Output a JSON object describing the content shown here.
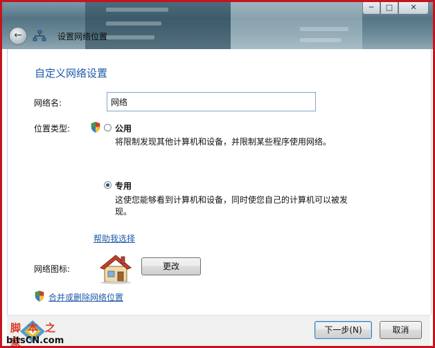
{
  "window": {
    "controls": {
      "minimize": "─",
      "maximize": "□",
      "close": "✕"
    }
  },
  "nav": {
    "back_icon": "back-arrow-icon",
    "network_icon": "network-icon",
    "title": "设置网络位置"
  },
  "page": {
    "heading": "自定义网络设置",
    "network_name_label": "网络名:",
    "network_name_value": "网络",
    "location_type_label": "位置类型:",
    "public_option": {
      "title": "公用",
      "description": "将限制发现其他计算机和设备，并限制某些程序使用网络。",
      "selected": false
    },
    "private_option": {
      "title": "专用",
      "description_line1": "这使您能够看到计算机和设备，同时使您自己的计算机可以被发",
      "description_line2": "现。",
      "selected": true
    },
    "help_link": "帮助我选择",
    "network_icon_label": "网络图标:",
    "change_button": "更改",
    "merge_link": "合并或删除网络位置"
  },
  "footer": {
    "next_button": "下一步(N)",
    "cancel_button": "取消"
  },
  "watermark": {
    "top": "脚本之家",
    "bottom": "bitsCN.com"
  }
}
